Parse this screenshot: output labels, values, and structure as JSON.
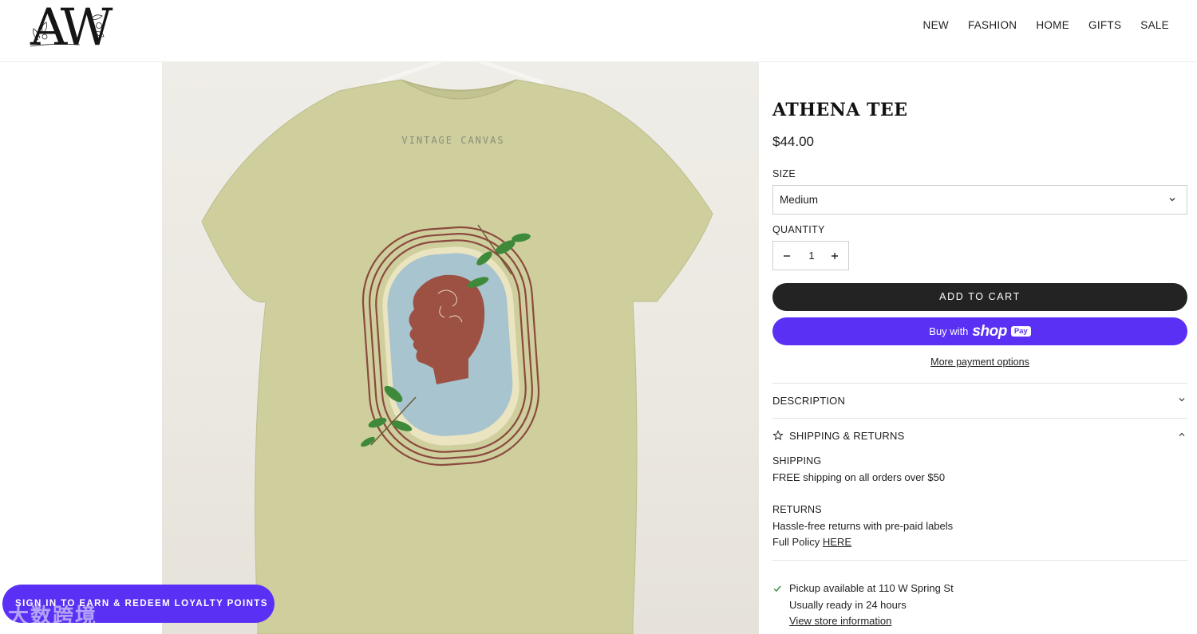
{
  "brand": {
    "logo_text": "AW"
  },
  "nav": {
    "items": [
      "NEW",
      "FASHION",
      "HOME",
      "GIFTS",
      "SALE"
    ]
  },
  "product_image": {
    "shirt_print_text": "VINTAGE CANVAS"
  },
  "product": {
    "title": "ATHENA TEE",
    "price": "$44.00",
    "size_label": "SIZE",
    "size_value": "Medium",
    "quantity_label": "QUANTITY",
    "quantity_value": "1",
    "add_to_cart": "ADD TO CART",
    "buy_with": "Buy with",
    "shop_word": "shop",
    "pay_badge": "Pay",
    "more_payment": "More payment options"
  },
  "accordion": {
    "description": "DESCRIPTION",
    "shipping_returns": "SHIPPING & RETURNS"
  },
  "shipping": {
    "shipping_head": "SHIPPING",
    "shipping_text": "FREE shipping on all orders over $50",
    "returns_head": "RETURNS",
    "returns_text": "Hassle-free returns with pre-paid labels",
    "policy_prefix": "Full Policy",
    "policy_link": "HERE"
  },
  "pickup": {
    "available": "Pickup available at 110 W Spring St",
    "ready": "Usually ready in 24 hours",
    "store_link": "View store information"
  },
  "loyalty": {
    "label": "SIGN IN TO EARN & REDEEM LOYALTY POINTS"
  },
  "watermark": {
    "text": "大数跨境"
  },
  "colors": {
    "shop_pay": "#5a31f4",
    "cart_button": "#232323",
    "shirt": "#cfcf9e"
  }
}
